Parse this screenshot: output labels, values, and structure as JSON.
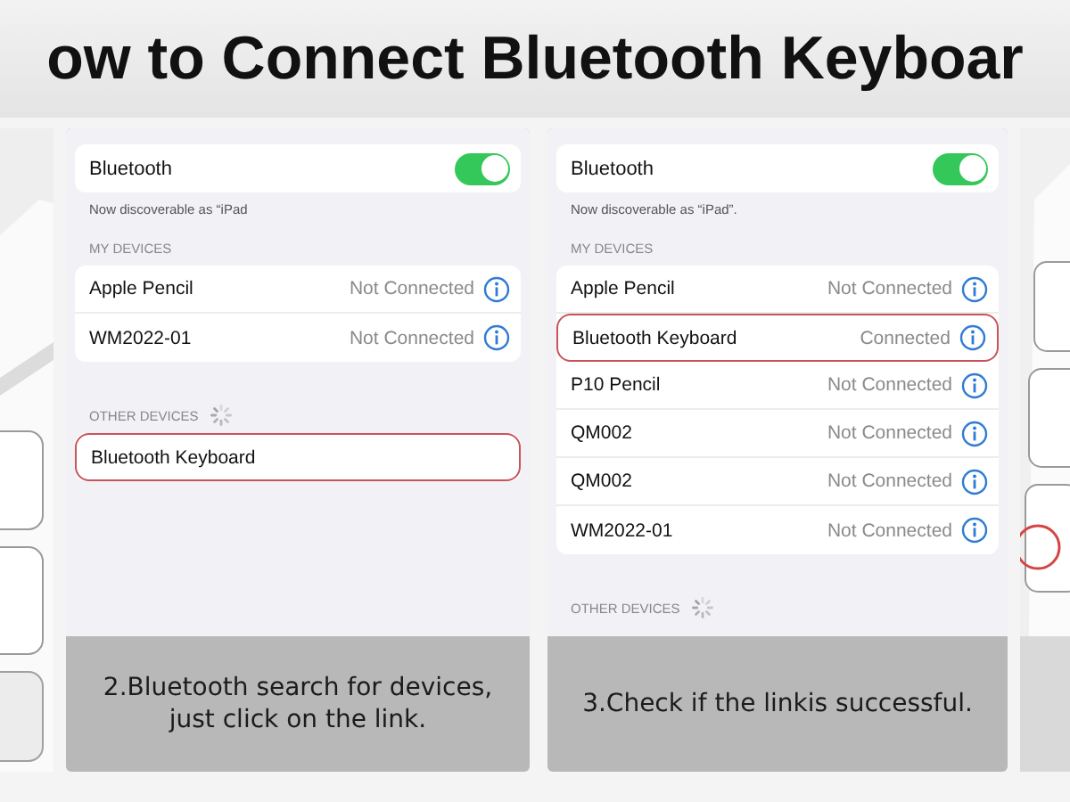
{
  "title": "ow to Connect Bluetooth Keyboar",
  "steps": [
    {
      "caption": "2.Bluetooth search for devices,\njust click on the link.",
      "screen": {
        "bluetooth": {
          "label": "Bluetooth",
          "on": true
        },
        "discoverable": "Now discoverable as “iPad",
        "sections": [
          {
            "header": "MY DEVICES",
            "searching": false,
            "devices": [
              {
                "name": "Apple Pencil",
                "status": "Not Connected",
                "highlighted": false
              },
              {
                "name": "WM2022-01",
                "status": "Not Connected",
                "highlighted": false
              }
            ]
          },
          {
            "header": "OTHER DEVICES",
            "searching": true,
            "devices": [
              {
                "name": "Bluetooth Keyboard",
                "highlighted": true
              }
            ]
          }
        ]
      }
    },
    {
      "caption": "3.Check if the linkis successful.",
      "screen": {
        "bluetooth": {
          "label": "Bluetooth",
          "on": true
        },
        "discoverable": "Now discoverable as “iPad”.",
        "sections": [
          {
            "header": "MY DEVICES",
            "searching": false,
            "devices": [
              {
                "name": "Apple Pencil",
                "status": "Not Connected",
                "highlighted": false
              },
              {
                "name": "Bluetooth Keyboard",
                "status": "Connected",
                "highlighted": true
              },
              {
                "name": "P10 Pencil",
                "status": "Not Connected",
                "highlighted": false
              },
              {
                "name": "QM002",
                "status": "Not Connected",
                "highlighted": false
              },
              {
                "name": "QM002",
                "status": "Not Connected",
                "highlighted": false
              },
              {
                "name": "WM2022-01",
                "status": "Not Connected",
                "highlighted": false
              }
            ]
          },
          {
            "header": "OTHER DEVICES",
            "searching": true
          }
        ]
      }
    }
  ]
}
